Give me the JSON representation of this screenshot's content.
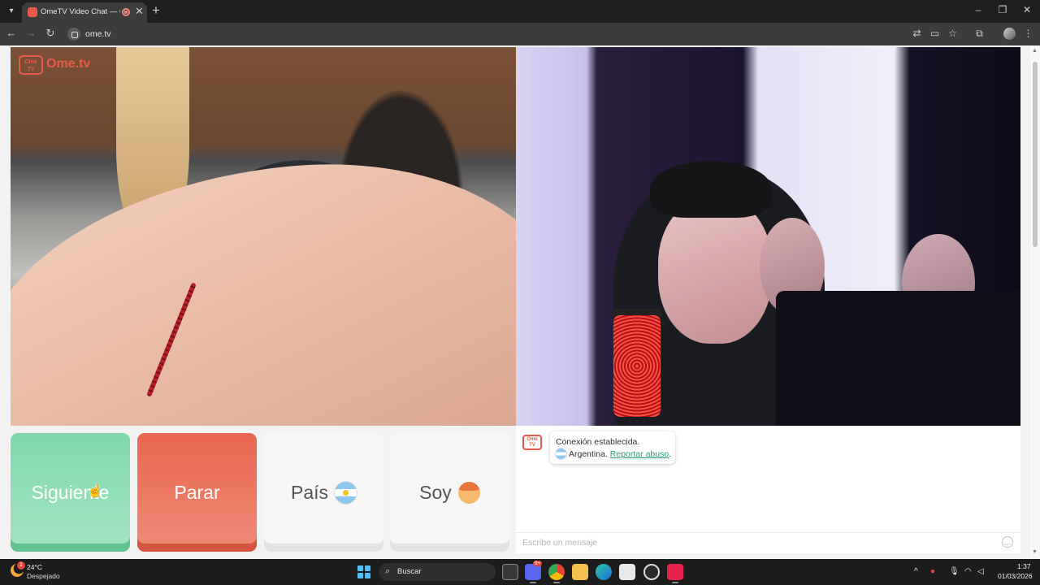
{
  "browser": {
    "tab_title": "OmeTV Video Chat — Omegle",
    "tab_close": "✕",
    "new_tab": "+",
    "url": "ome.tv",
    "icons": [
      "tab-menu-icon",
      "favicon-icon",
      "recording-icon",
      "back-icon",
      "forward-icon",
      "reload-icon",
      "site-info-icon",
      "translate-icon",
      "cast-icon",
      "bookmark-star-icon",
      "extensions-icon",
      "profile-avatar-icon",
      "more-menu-icon",
      "minimize-icon",
      "restore-icon",
      "close-window-icon"
    ]
  },
  "logo": {
    "badge_line1": "Ome",
    "badge_line2": "TV",
    "word": "Ome.tv",
    "brand_color": "#e85a4a"
  },
  "controls": {
    "next_label": "Siguiente",
    "stop_label": "Parar",
    "country_label": "País",
    "country_flag": "argentina-flag-icon",
    "gender_label": "Soy",
    "gender_icon": "boy-emoji-icon",
    "next_color": "#7fd8aa",
    "stop_color": "#e9664f"
  },
  "chat": {
    "status": "Conexión establecida.",
    "country": "Argentina.",
    "report_link": "Reportar abuso",
    "report_suffix": ".",
    "input_placeholder": "Escribe un mensaje",
    "link_color": "#2b9d6e"
  },
  "taskbar": {
    "weather_temp": "24°C",
    "weather_desc": "Despejado",
    "weather_badge": "1",
    "search_label": "Buscar",
    "time": "1:37",
    "date": "01/03/2026",
    "discord_badge": "9+"
  }
}
